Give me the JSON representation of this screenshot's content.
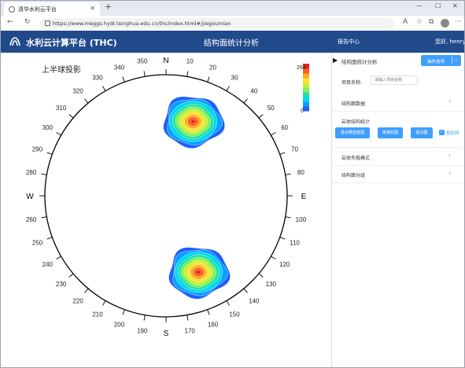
{
  "browser": {
    "tab_title": "清华水利云平台",
    "url": "https://www.meggs.hydr.tsinghua.edu.cn/thc/index.html#/jiegoumian"
  },
  "app": {
    "title": "水利云计算平台 (THC)",
    "page_title": "结构面统计分析",
    "nav_link": "报告中心",
    "greeting": "您好, henry"
  },
  "plot": {
    "hemisphere_label": "上半球投影",
    "cardinals": {
      "north": "N",
      "east": "E",
      "south": "S",
      "west": "W"
    },
    "azimuth_labels": [
      "10",
      "20",
      "30",
      "40",
      "50",
      "60",
      "70",
      "80",
      "100",
      "110",
      "120",
      "130",
      "140",
      "150",
      "160",
      "170",
      "190",
      "200",
      "210",
      "220",
      "230",
      "240",
      "250",
      "260",
      "280",
      "290",
      "300",
      "310",
      "320",
      "330",
      "340",
      "350"
    ],
    "colorbar": {
      "max_label": "264",
      "min_label": "0",
      "colors": [
        "#1f5fff",
        "#0aa0ff",
        "#00d8f0",
        "#22e0a0",
        "#7cf05a",
        "#c6f032",
        "#ffe12a",
        "#ffaa22",
        "#ff5a1e",
        "#e61e1e"
      ]
    },
    "clusters": [
      {
        "trend_deg": 20,
        "plunge_deg": 35
      },
      {
        "trend_deg": 157,
        "plunge_deg": 32
      }
    ]
  },
  "panel": {
    "title": "结构面统计分析",
    "options_button": "操作选项",
    "project_label": "项目名称:",
    "project_placeholder": "请输入项目名称",
    "section_data": "结构面数据",
    "section_rock_stats": "岩体结构统计",
    "buttons": [
      "极点等密度图",
      "玫瑰花图",
      "极点图"
    ],
    "checkbox_label": "投影网",
    "section_failure": "岩体失稳模式",
    "section_grouping": "结构面分组"
  }
}
